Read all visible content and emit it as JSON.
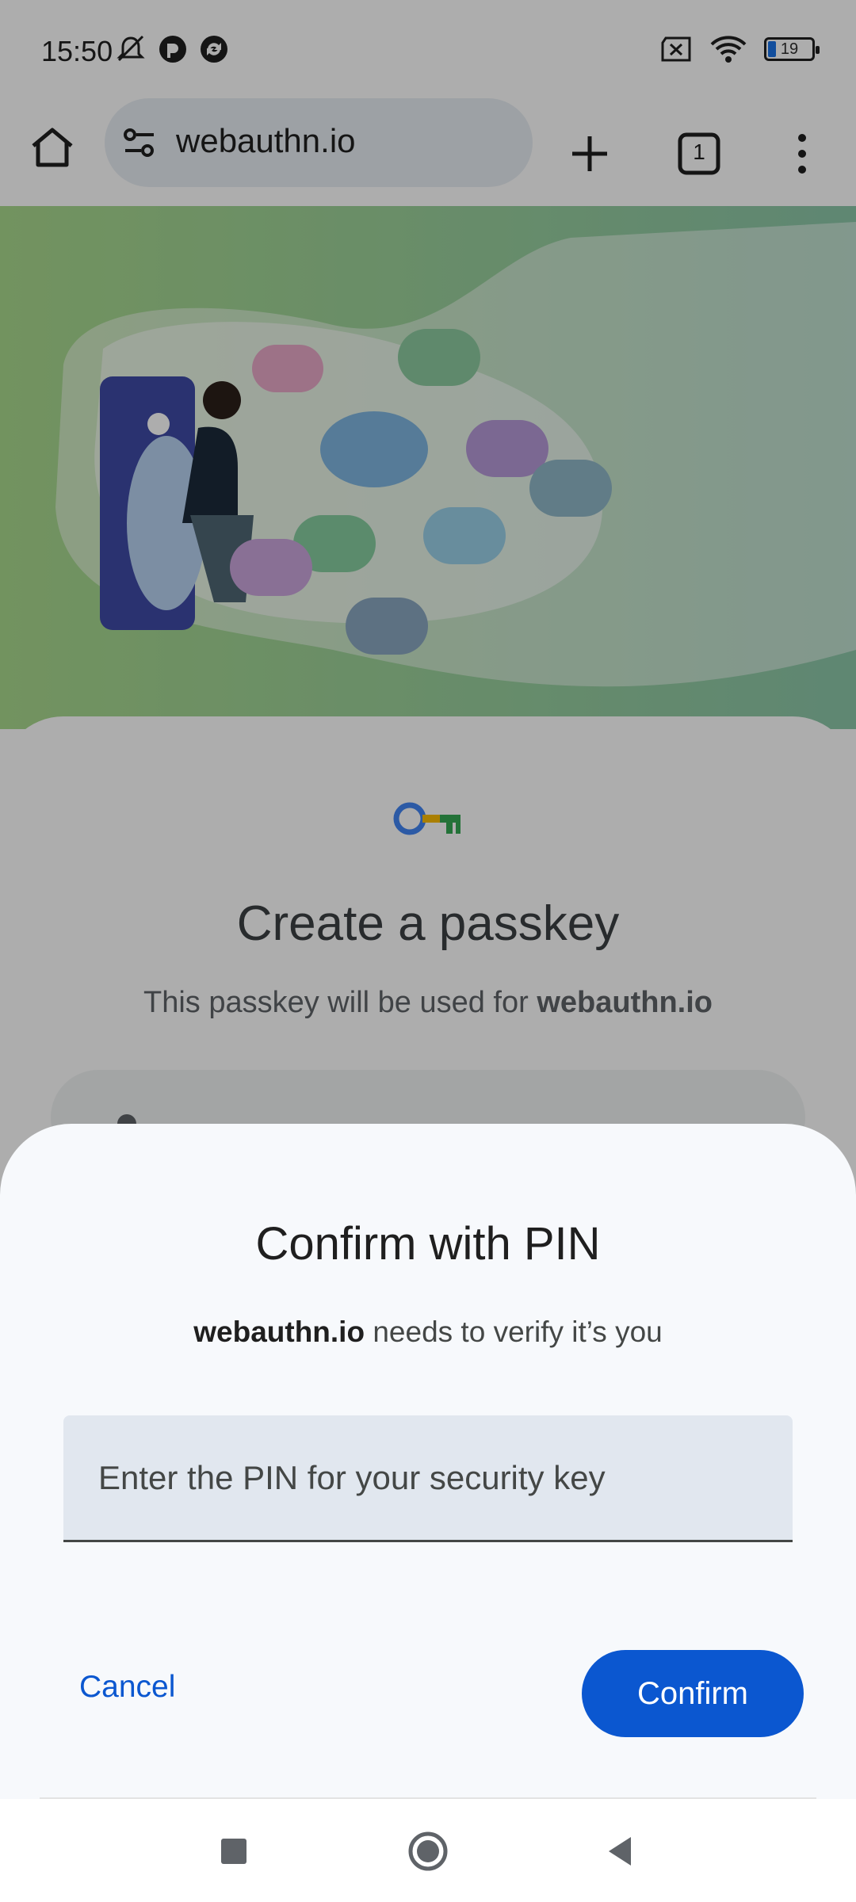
{
  "status_bar": {
    "time": "15:50",
    "battery": "19"
  },
  "browser": {
    "url": "webauthn.io",
    "tab_count": "1"
  },
  "page": {
    "passkey_title": "Create a passkey",
    "passkey_subtitle_prefix": "This passkey will be used for ",
    "passkey_subtitle_site": "webauthn.io"
  },
  "dialog": {
    "title": "Confirm with PIN",
    "site": "webauthn.io",
    "message": " needs to verify it’s you",
    "pin_placeholder": "Enter the PIN for your security key",
    "pin_value": "",
    "cancel_label": "Cancel",
    "confirm_label": "Confirm"
  },
  "colors": {
    "accent": "#0b57d0",
    "sheet_bg": "#f7f9fc",
    "input_bg": "#e1e7ef"
  },
  "icons": [
    "mute-bell-icon",
    "app-notification-icon",
    "sync-notification-icon",
    "sim-off-icon",
    "wifi-icon",
    "battery-icon",
    "home-icon",
    "site-settings-icon",
    "new-tab-icon",
    "tab-switcher-icon",
    "more-menu-icon",
    "passkey-key-icon",
    "recents-icon",
    "home-circle-icon",
    "back-icon"
  ]
}
